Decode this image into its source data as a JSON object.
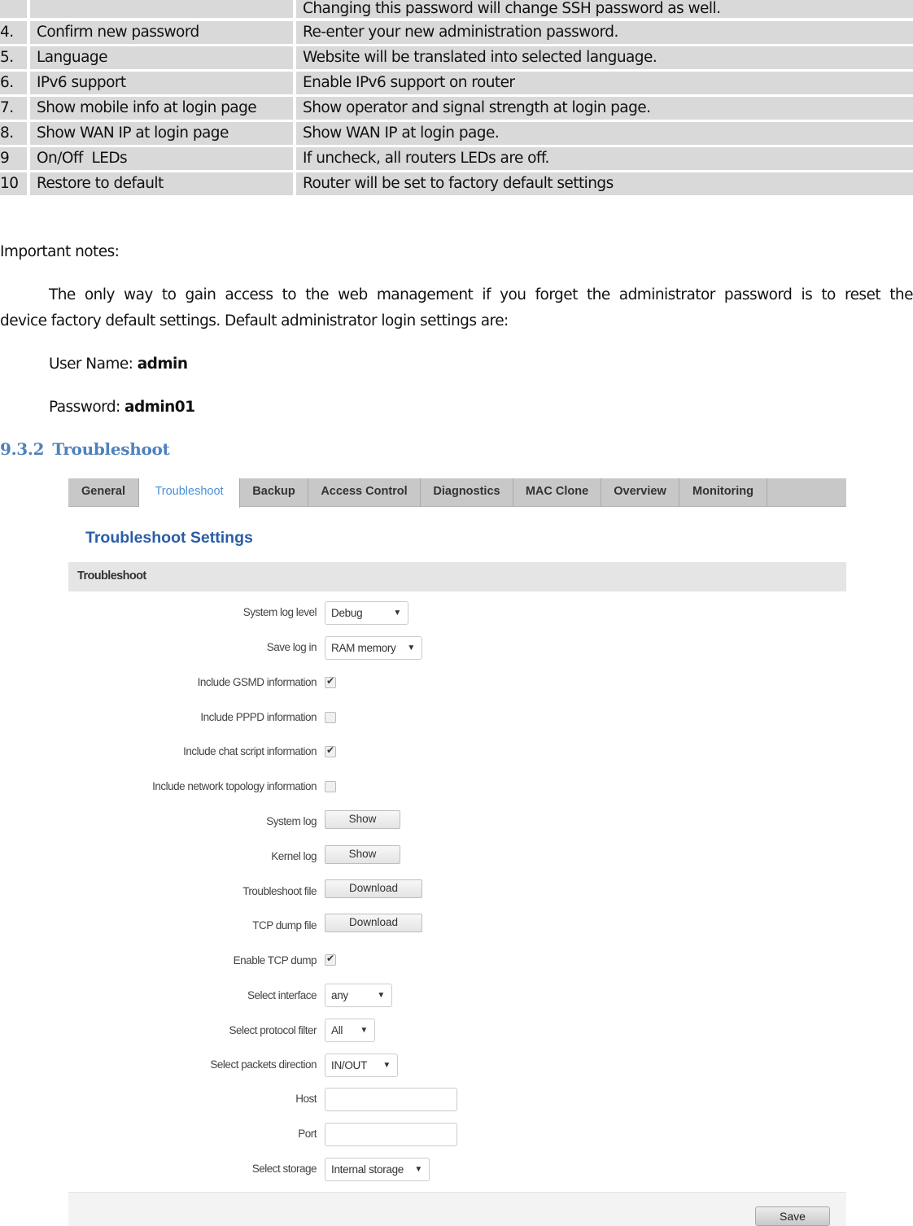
{
  "table": {
    "rows": [
      {
        "num": "",
        "name": "",
        "desc": "Changing this password will change SSH password as well."
      },
      {
        "num": "4.",
        "name": "Confirm new password",
        "desc": "Re-enter your new administration password."
      },
      {
        "num": "5.",
        "name": "Language",
        "desc": "Website will be translated into selected language."
      },
      {
        "num": "6.",
        "name": "IPv6 support",
        "desc": "Enable IPv6 support on router"
      },
      {
        "num": "7.",
        "name": "Show mobile info at login page",
        "desc": "Show operator and signal strength at login page."
      },
      {
        "num": "8.",
        "name": "Show WAN IP at login page",
        "desc": "Show WAN IP at login page."
      },
      {
        "num": "9",
        "name": "On/Off  LEDs",
        "desc": "If uncheck, all routers LEDs are off."
      },
      {
        "num": "10",
        "name": "Restore to default",
        "desc": "Router will be set to factory default settings"
      }
    ]
  },
  "notes": {
    "heading": "Important notes:",
    "para_line1_words": [
      "The",
      "only",
      "way",
      "to",
      "gain",
      "access",
      "to",
      "the",
      "web",
      "management",
      "if",
      "you",
      "forget",
      "the",
      "administrator",
      "password",
      "is",
      "to",
      "reset",
      "the"
    ],
    "para_line2": "device factory default settings. Default administrator login settings are:",
    "username_label": "User Name: ",
    "username_value": "admin",
    "password_label": "Password: ",
    "password_value": "admin01"
  },
  "section": {
    "number": "9.3.2",
    "title": "Troubleshoot"
  },
  "ui": {
    "tabs": [
      {
        "label": "General",
        "active": false
      },
      {
        "label": "Troubleshoot",
        "active": true
      },
      {
        "label": "Backup",
        "active": false
      },
      {
        "label": "Access Control",
        "active": false
      },
      {
        "label": "Diagnostics",
        "active": false
      },
      {
        "label": "MAC Clone",
        "active": false
      },
      {
        "label": "Overview",
        "active": false
      },
      {
        "label": "Monitoring",
        "active": false
      }
    ],
    "page_title": "Troubleshoot Settings",
    "section_title": "Troubleshoot",
    "fields": {
      "system_log_level": {
        "label": "System log level",
        "value": "Debug"
      },
      "save_log_in": {
        "label": "Save log in",
        "value": "RAM memory"
      },
      "include_gsmd": {
        "label": "Include GSMD information",
        "checked": true
      },
      "include_pppd": {
        "label": "Include PPPD information",
        "checked": false
      },
      "include_chat": {
        "label": "Include chat script information",
        "checked": true
      },
      "include_topology": {
        "label": "Include network topology information",
        "checked": false
      },
      "system_log": {
        "label": "System log",
        "button": "Show"
      },
      "kernel_log": {
        "label": "Kernel log",
        "button": "Show"
      },
      "troubleshoot_file": {
        "label": "Troubleshoot file",
        "button": "Download"
      },
      "tcp_dump_file": {
        "label": "TCP dump file",
        "button": "Download"
      },
      "enable_tcp_dump": {
        "label": "Enable TCP dump",
        "checked": true
      },
      "select_interface": {
        "label": "Select interface",
        "value": "any"
      },
      "select_protocol": {
        "label": "Select protocol filter",
        "value": "All"
      },
      "select_direction": {
        "label": "Select packets direction",
        "value": "IN/OUT"
      },
      "host": {
        "label": "Host",
        "value": ""
      },
      "port": {
        "label": "Port",
        "value": ""
      },
      "select_storage": {
        "label": "Select storage",
        "value": "Internal storage"
      }
    },
    "save_label": "Save",
    "dropdown_arrow": "▼",
    "check_mark": "✔",
    "colors": {
      "active_tab": "#4a90d9",
      "title": "#2a5da8",
      "heading": "#4f81bd"
    }
  }
}
